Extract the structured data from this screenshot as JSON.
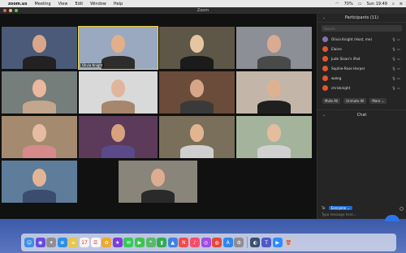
{
  "menubar": {
    "app": "zoom.us",
    "items": [
      "Meeting",
      "View",
      "Edit",
      "Window",
      "Help"
    ],
    "battery": "70%",
    "time": "Sun 19:49"
  },
  "window": {
    "title": "Zoom"
  },
  "gallery": {
    "tiles": [
      {
        "name": "",
        "bg": "#4a5a78",
        "skin": "#d9a58b",
        "shirt": "#222"
      },
      {
        "name": "Olivia Knight",
        "bg": "#9aa9bf",
        "skin": "#e1b08b",
        "shirt": "#2d2d2d",
        "active": true
      },
      {
        "name": "",
        "bg": "#5e5748",
        "skin": "#e6c5a2",
        "shirt": "#1b1b1b"
      },
      {
        "name": "",
        "bg": "#8d8f96",
        "skin": "#d9ab92",
        "shirt": "#4a4a4a"
      },
      {
        "name": "",
        "bg": "#757e7a",
        "skin": "#e9b89e",
        "shirt": "#c2a68d"
      },
      {
        "name": "",
        "bg": "#d9d9d9",
        "skin": "#e0b59b",
        "shirt": "#a6866d"
      },
      {
        "name": "",
        "bg": "#6b4b3a",
        "skin": "#d7a688",
        "shirt": "#3a3a3a"
      },
      {
        "name": "",
        "bg": "#c3b6a8",
        "skin": "#dfb193",
        "shirt": "#1f1f1f"
      },
      {
        "name": "",
        "bg": "#a48b70",
        "skin": "#e5bca2",
        "shirt": "#d78a8a"
      },
      {
        "name": "",
        "bg": "#5b3a5a",
        "skin": "#d8a17f",
        "shirt": "#5a4a8a"
      },
      {
        "name": "",
        "bg": "#7a6f5a",
        "skin": "#e2b592",
        "shirt": "#cfcfcf"
      },
      {
        "name": "",
        "bg": "#a4b39c",
        "skin": "#e4bc9f",
        "shirt": "#d0d0d0"
      },
      {
        "name": "",
        "bg": "#5e7d9a",
        "skin": "#e3b596",
        "shirt": "#3c4c6c"
      },
      {
        "name": "",
        "bg": "#8a857a",
        "skin": "#dcad92",
        "shirt": "#2a2a2a"
      }
    ]
  },
  "panel": {
    "participants_title": "Participants (11)",
    "collapse_icon": "chevron-down-icon",
    "search_placeholder": "Search",
    "participants": [
      {
        "name": "Olivia Knight (Host, me)",
        "color": "#8a6fb0"
      },
      {
        "name": "Elaine",
        "color": "#e0562e"
      },
      {
        "name": "Jude Sloan's iPad",
        "color": "#e0562e"
      },
      {
        "name": "Sophie-Rose Harper",
        "color": "#e0562e"
      },
      {
        "name": "waleg",
        "color": "#e0562e"
      },
      {
        "name": "chrisknight",
        "color": "#e0562e"
      }
    ],
    "buttons": [
      "Mute All",
      "Unmute All",
      "More"
    ],
    "chat_title": "Chat",
    "to_label": "To:",
    "to_value": "Everyone",
    "message_placeholder": "Type message here..."
  },
  "dock": {
    "icons": [
      {
        "name": "finder-icon",
        "color": "#3d8ee6",
        "glyph": "☺"
      },
      {
        "name": "siri-icon",
        "color": "#6a4be0",
        "glyph": "◉"
      },
      {
        "name": "launchpad-icon",
        "color": "#8e8e93",
        "glyph": "✦"
      },
      {
        "name": "safari-icon",
        "color": "#2d8ee6",
        "glyph": "⊕"
      },
      {
        "name": "notes-icon",
        "color": "#e8c64a",
        "glyph": "≡"
      },
      {
        "name": "calendar-icon",
        "color": "#f2f2f2",
        "glyph": "17"
      },
      {
        "name": "reminders-icon",
        "color": "#f7f7f7",
        "glyph": "☰"
      },
      {
        "name": "photos-icon",
        "color": "#f0a830",
        "glyph": "✿"
      },
      {
        "name": "imovie-icon",
        "color": "#7a3fd6",
        "glyph": "★"
      },
      {
        "name": "messages-icon",
        "color": "#37c85a",
        "glyph": "✉"
      },
      {
        "name": "facetime-icon",
        "color": "#3ec451",
        "glyph": "▶"
      },
      {
        "name": "maps-icon",
        "color": "#59b86a",
        "glyph": "⌖"
      },
      {
        "name": "numbers-icon",
        "color": "#2fae4f",
        "glyph": "▮"
      },
      {
        "name": "keynote-icon",
        "color": "#3b82e6",
        "glyph": "▲"
      },
      {
        "name": "news-icon",
        "color": "#f04b4b",
        "glyph": "N"
      },
      {
        "name": "music-icon",
        "color": "#fb4c65",
        "glyph": "♪"
      },
      {
        "name": "podcasts-icon",
        "color": "#a24ce0",
        "glyph": "◎"
      },
      {
        "name": "chrome-icon",
        "color": "#e24a3b",
        "glyph": "◍"
      },
      {
        "name": "appstore-icon",
        "color": "#2f86f0",
        "glyph": "A"
      },
      {
        "name": "system-preferences-icon",
        "color": "#8d8d92",
        "glyph": "⚙"
      },
      {
        "name": "sep",
        "color": "",
        "glyph": ""
      },
      {
        "name": "screen-saver-icon",
        "color": "#3a4f70",
        "glyph": "◐"
      },
      {
        "name": "teams-icon",
        "color": "#5059c9",
        "glyph": "T"
      },
      {
        "name": "zoom-icon",
        "color": "#2d8cff",
        "glyph": "▶"
      },
      {
        "name": "trash-icon",
        "color": "#c8c8cc",
        "glyph": "🗑"
      }
    ]
  }
}
